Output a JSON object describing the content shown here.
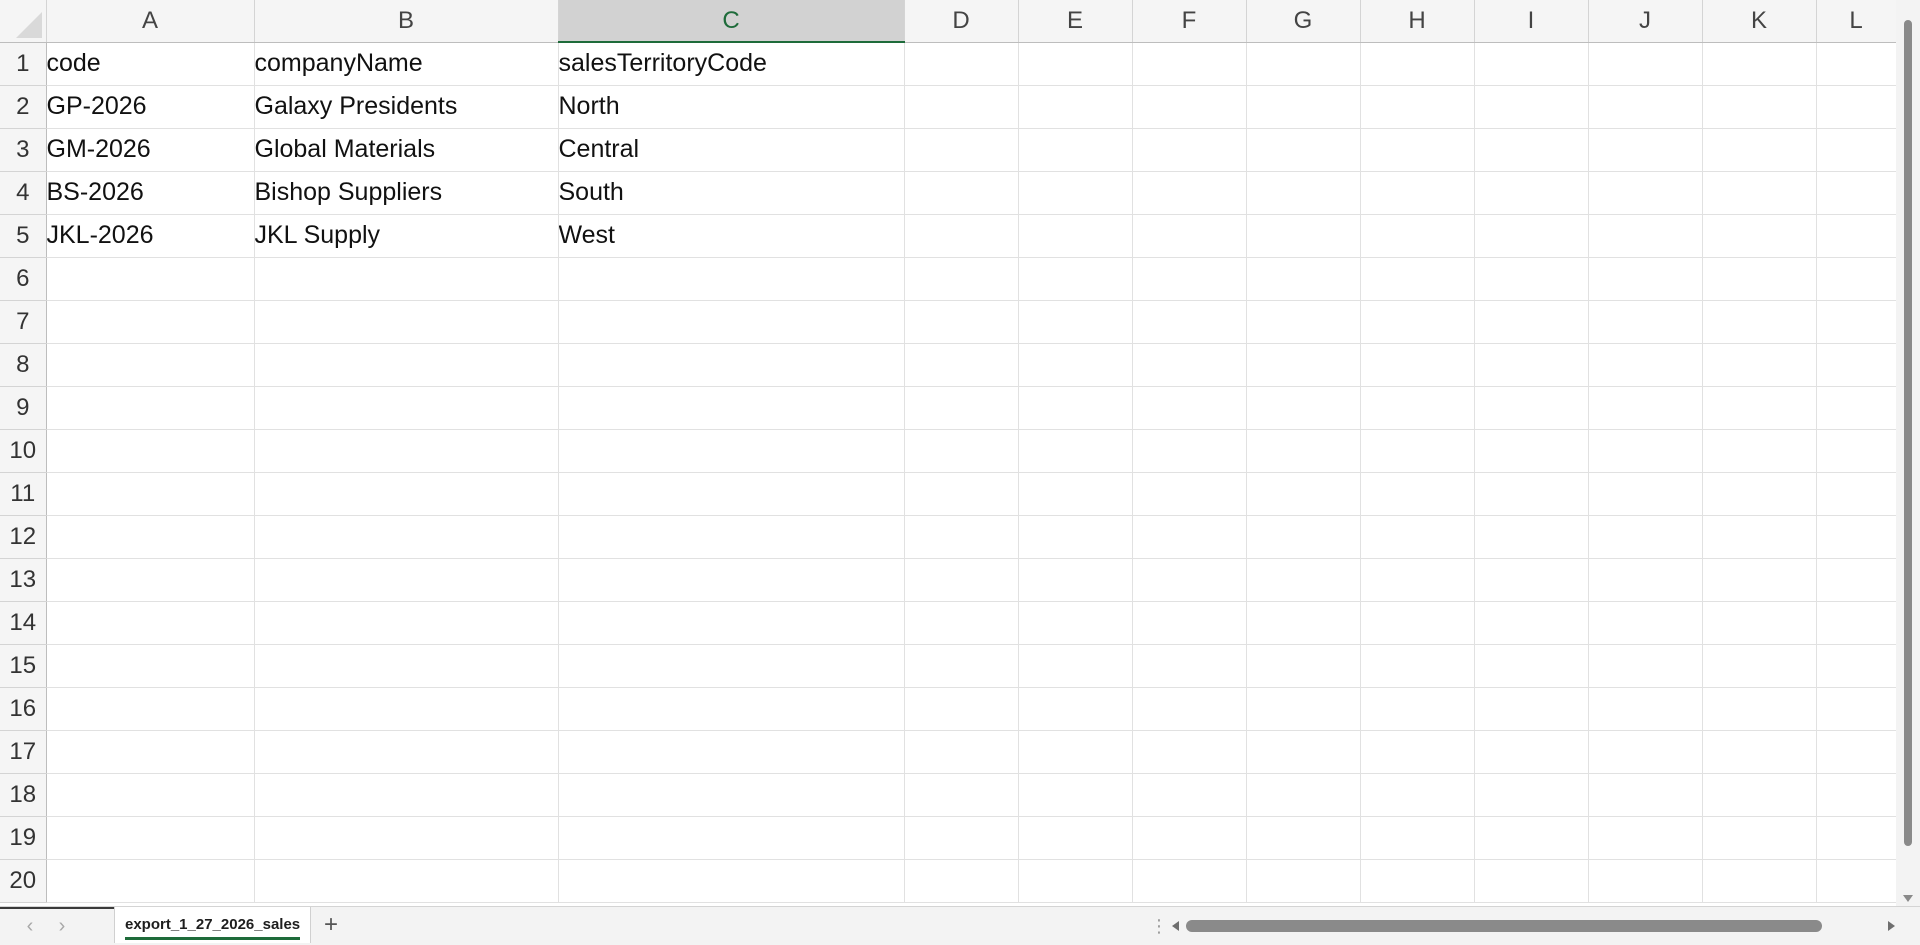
{
  "columns": [
    "A",
    "B",
    "C",
    "D",
    "E",
    "F",
    "G",
    "H",
    "I",
    "J",
    "K",
    "L"
  ],
  "selected_column": "C",
  "rows": [
    {
      "num": "1",
      "cells": [
        "code",
        "companyName",
        "salesTerritoryCode",
        "",
        "",
        "",
        "",
        "",
        "",
        "",
        "",
        ""
      ]
    },
    {
      "num": "2",
      "cells": [
        "GP-2026",
        "Galaxy Presidents",
        "North",
        "",
        "",
        "",
        "",
        "",
        "",
        "",
        "",
        ""
      ]
    },
    {
      "num": "3",
      "cells": [
        "GM-2026",
        "Global Materials",
        "Central",
        "",
        "",
        "",
        "",
        "",
        "",
        "",
        "",
        ""
      ]
    },
    {
      "num": "4",
      "cells": [
        "BS-2026",
        "Bishop Suppliers",
        "South",
        "",
        "",
        "",
        "",
        "",
        "",
        "",
        "",
        ""
      ]
    },
    {
      "num": "5",
      "cells": [
        "JKL-2026",
        "JKL Supply",
        "West",
        "",
        "",
        "",
        "",
        "",
        "",
        "",
        "",
        ""
      ]
    },
    {
      "num": "6",
      "cells": [
        "",
        "",
        "",
        "",
        "",
        "",
        "",
        "",
        "",
        "",
        "",
        ""
      ]
    },
    {
      "num": "7",
      "cells": [
        "",
        "",
        "",
        "",
        "",
        "",
        "",
        "",
        "",
        "",
        "",
        ""
      ]
    },
    {
      "num": "8",
      "cells": [
        "",
        "",
        "",
        "",
        "",
        "",
        "",
        "",
        "",
        "",
        "",
        ""
      ]
    },
    {
      "num": "9",
      "cells": [
        "",
        "",
        "",
        "",
        "",
        "",
        "",
        "",
        "",
        "",
        "",
        ""
      ]
    },
    {
      "num": "10",
      "cells": [
        "",
        "",
        "",
        "",
        "",
        "",
        "",
        "",
        "",
        "",
        "",
        ""
      ]
    },
    {
      "num": "11",
      "cells": [
        "",
        "",
        "",
        "",
        "",
        "",
        "",
        "",
        "",
        "",
        "",
        ""
      ]
    },
    {
      "num": "12",
      "cells": [
        "",
        "",
        "",
        "",
        "",
        "",
        "",
        "",
        "",
        "",
        "",
        ""
      ]
    },
    {
      "num": "13",
      "cells": [
        "",
        "",
        "",
        "",
        "",
        "",
        "",
        "",
        "",
        "",
        "",
        ""
      ]
    },
    {
      "num": "14",
      "cells": [
        "",
        "",
        "",
        "",
        "",
        "",
        "",
        "",
        "",
        "",
        "",
        ""
      ]
    },
    {
      "num": "15",
      "cells": [
        "",
        "",
        "",
        "",
        "",
        "",
        "",
        "",
        "",
        "",
        "",
        ""
      ]
    },
    {
      "num": "16",
      "cells": [
        "",
        "",
        "",
        "",
        "",
        "",
        "",
        "",
        "",
        "",
        "",
        ""
      ]
    },
    {
      "num": "17",
      "cells": [
        "",
        "",
        "",
        "",
        "",
        "",
        "",
        "",
        "",
        "",
        "",
        ""
      ]
    },
    {
      "num": "18",
      "cells": [
        "",
        "",
        "",
        "",
        "",
        "",
        "",
        "",
        "",
        "",
        "",
        ""
      ]
    },
    {
      "num": "19",
      "cells": [
        "",
        "",
        "",
        "",
        "",
        "",
        "",
        "",
        "",
        "",
        "",
        ""
      ]
    },
    {
      "num": "20",
      "cells": [
        "",
        "",
        "",
        "",
        "",
        "",
        "",
        "",
        "",
        "",
        "",
        ""
      ]
    }
  ],
  "sheet_tabs": [
    {
      "label": "export_1_27_2026_sales",
      "active": true
    }
  ],
  "icons": {
    "prev_sheet": "chevron-left-icon",
    "next_sheet": "chevron-right-icon",
    "add_sheet": "plus-icon",
    "add_sheet_glyph": "+",
    "prev_glyph": "‹",
    "next_glyph": "›",
    "dots_glyph": "⋮"
  },
  "colors": {
    "accent": "#1e6b3a",
    "selected_header_bg": "#d2d2d2"
  }
}
